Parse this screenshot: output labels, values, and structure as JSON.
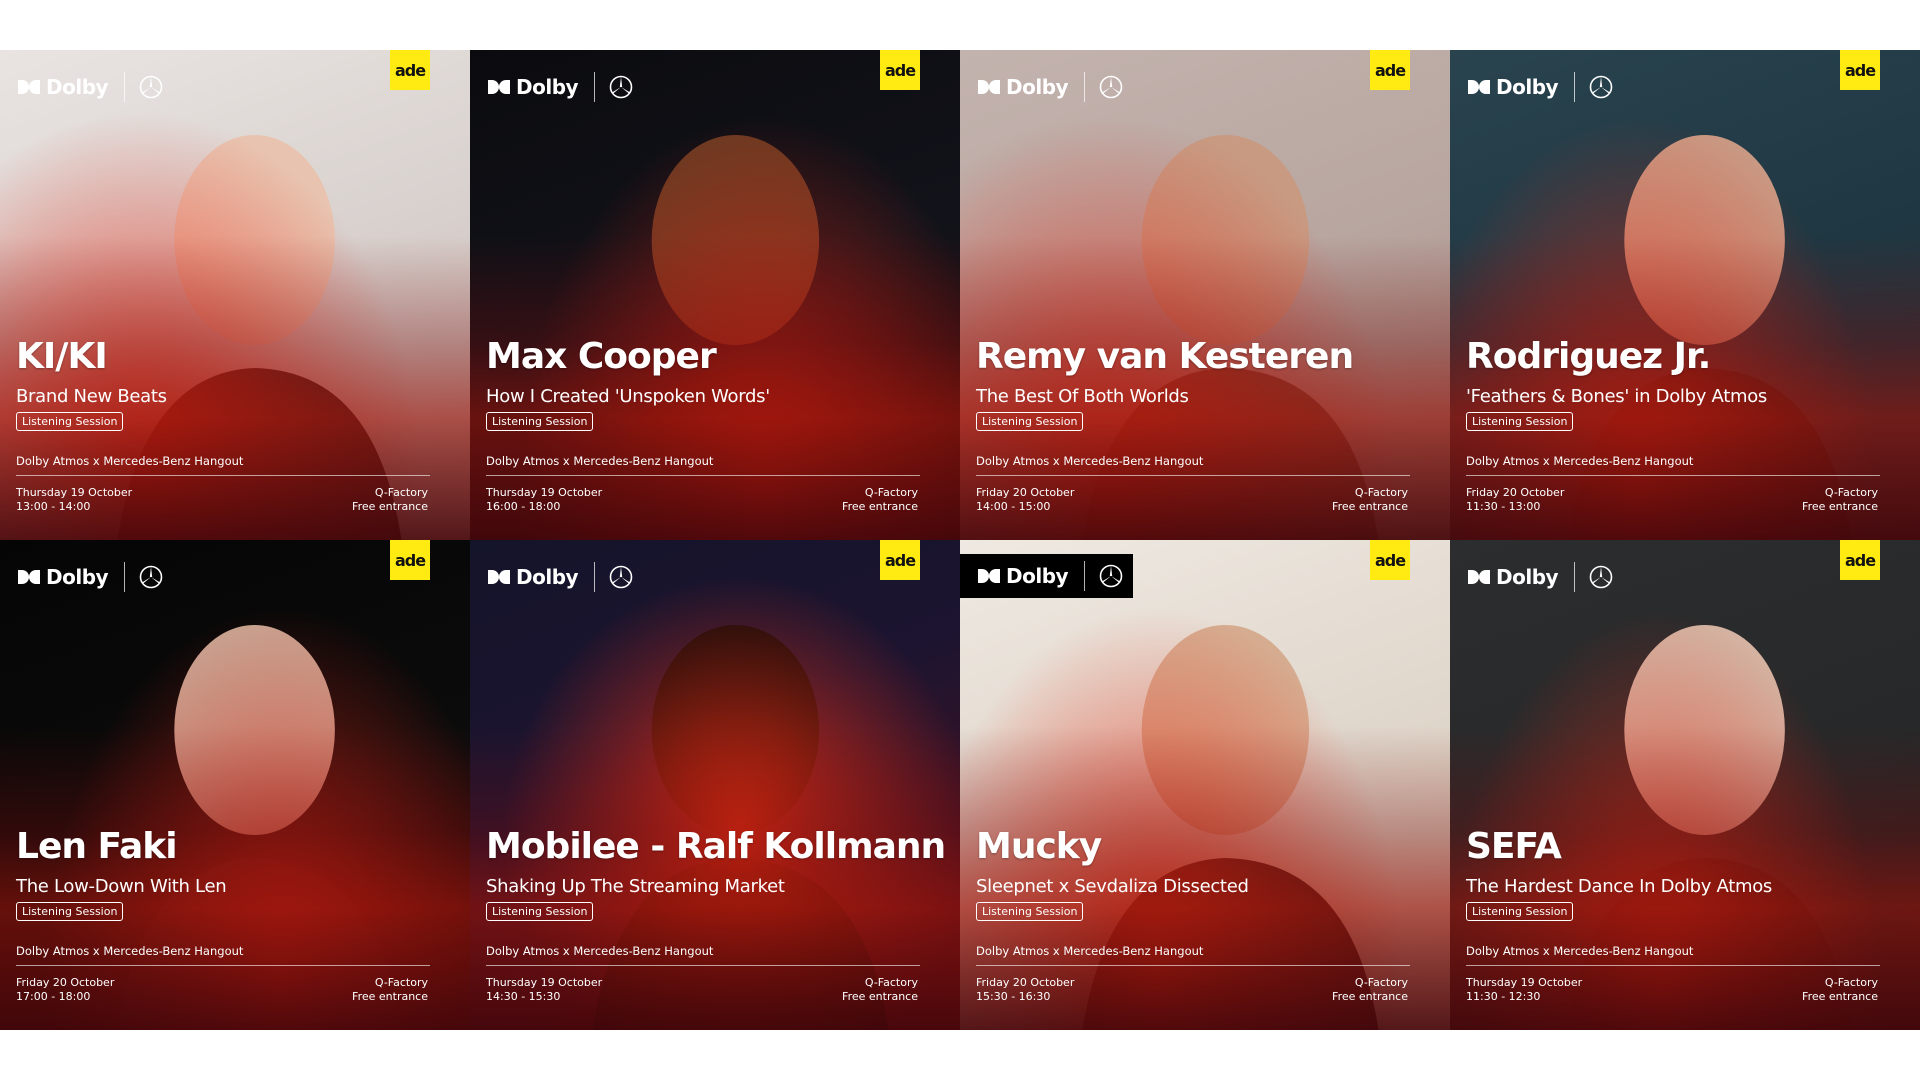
{
  "brand": {
    "dolby_label": "Dolby",
    "ade_label": "ade"
  },
  "cards": [
    {
      "artist": "KI/KI",
      "subtitle": "Brand New Beats",
      "badge": "Listening Session",
      "venue": "Dolby Atmos x Mercedes-Benz Hangout",
      "date": "Thursday 19 October",
      "time": "13:00 - 14:00",
      "location": "Q-Factory",
      "entry": "Free entrance"
    },
    {
      "artist": "Max Cooper",
      "subtitle": "How I Created 'Unspoken Words'",
      "badge": "Listening Session",
      "venue": "Dolby Atmos x Mercedes-Benz Hangout",
      "date": "Thursday 19 October",
      "time": "16:00 - 18:00",
      "location": "Q-Factory",
      "entry": "Free entrance"
    },
    {
      "artist": "Remy van Kesteren",
      "subtitle": "The Best Of Both Worlds",
      "badge": "Listening Session",
      "venue": "Dolby Atmos x Mercedes-Benz Hangout",
      "date": "Friday 20 October",
      "time": "14:00 - 15:00",
      "location": "Q-Factory",
      "entry": "Free entrance"
    },
    {
      "artist": "Rodriguez Jr.",
      "subtitle": "'Feathers & Bones' in Dolby Atmos",
      "badge": "Listening Session",
      "venue": "Dolby Atmos x Mercedes-Benz Hangout",
      "date": "Friday 20 October",
      "time": "11:30 - 13:00",
      "location": "Q-Factory",
      "entry": "Free entrance"
    },
    {
      "artist": "Len Faki",
      "subtitle": "The Low-Down With Len",
      "badge": "Listening Session",
      "venue": "Dolby Atmos x Mercedes-Benz Hangout",
      "date": "Friday 20 October",
      "time": "17:00 - 18:00",
      "location": "Q-Factory",
      "entry": "Free entrance"
    },
    {
      "artist": "Mobilee - Ralf Kollmann",
      "subtitle": "Shaking Up The Streaming Market",
      "badge": "Listening Session",
      "venue": "Dolby Atmos x Mercedes-Benz Hangout",
      "date": "Thursday 19 October",
      "time": "14:30 - 15:30",
      "location": "Q-Factory",
      "entry": "Free entrance"
    },
    {
      "artist": "Mucky",
      "subtitle": "Sleepnet x Sevdaliza Dissected",
      "badge": "Listening Session",
      "venue": "Dolby Atmos x Mercedes-Benz Hangout",
      "date": "Friday 20 October",
      "time": "15:30 - 16:30",
      "location": "Q-Factory",
      "entry": "Free entrance"
    },
    {
      "artist": "SEFA",
      "subtitle": "The Hardest Dance In Dolby Atmos",
      "badge": "Listening Session",
      "venue": "Dolby Atmos x Mercedes-Benz Hangout",
      "date": "Thursday 19 October",
      "time": "11:30 - 12:30",
      "location": "Q-Factory",
      "entry": "Free entrance"
    }
  ],
  "colors": {
    "ade_yellow": "#ffeb12",
    "accent_red": "#e52a12",
    "text_white": "#ffffff"
  }
}
